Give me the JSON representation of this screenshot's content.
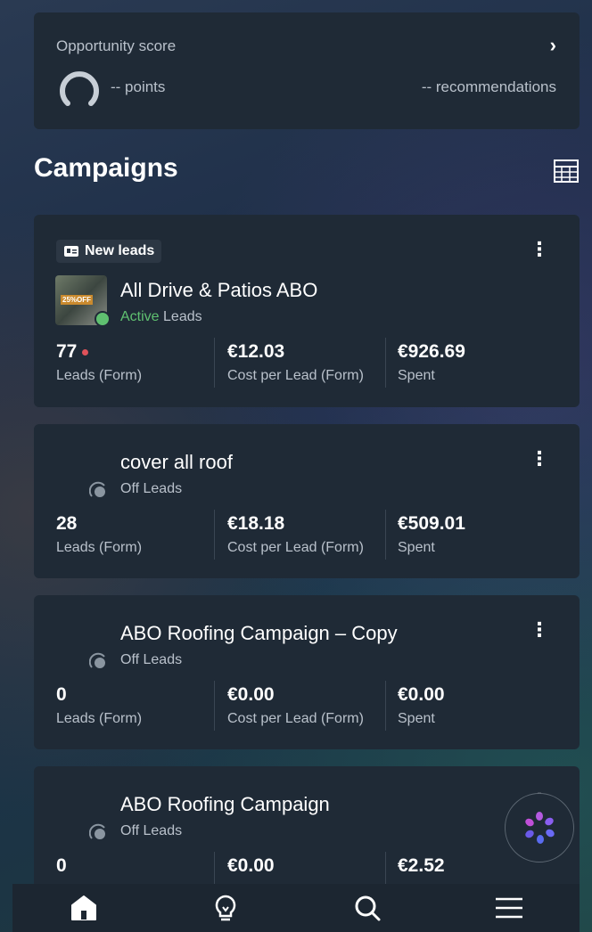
{
  "opportunity": {
    "label": "Opportunity score",
    "points": "-- points",
    "recommendations": "-- recommendations"
  },
  "section_title": "Campaigns",
  "campaigns": [
    {
      "badge": "New leads",
      "name": "All Drive & Patios ABO",
      "status_state": "Active",
      "status_type": "Leads",
      "thumb_tag": "25%OFF",
      "metrics": [
        {
          "value": "77",
          "label": "Leads (Form)"
        },
        {
          "value": "€12.03",
          "label": "Cost per Lead (Form)"
        },
        {
          "value": "€926.69",
          "label": "Spent"
        }
      ]
    },
    {
      "name": "cover all roof",
      "status_state": "Off",
      "status_type": "Leads",
      "metrics": [
        {
          "value": "28",
          "label": "Leads (Form)"
        },
        {
          "value": "€18.18",
          "label": "Cost per Lead (Form)"
        },
        {
          "value": "€509.01",
          "label": "Spent"
        }
      ]
    },
    {
      "name": "ABO Roofing Campaign – Copy",
      "status_state": "Off",
      "status_type": "Leads",
      "metrics": [
        {
          "value": "0",
          "label": "Leads (Form)"
        },
        {
          "value": "€0.00",
          "label": "Cost per Lead (Form)"
        },
        {
          "value": "€0.00",
          "label": "Spent"
        }
      ]
    },
    {
      "name": "ABO Roofing Campaign",
      "status_state": "Off",
      "status_type": "Leads",
      "metrics": [
        {
          "value": "0",
          "label": ""
        },
        {
          "value": "€0.00",
          "label": ""
        },
        {
          "value": "€2.52",
          "label": ""
        }
      ]
    }
  ],
  "nav": [
    "home-icon",
    "lightbulb-icon",
    "search-icon",
    "menu-icon"
  ],
  "colors": {
    "active": "#5fc070",
    "card": "#1f2a36",
    "alert": "#e0525a"
  }
}
